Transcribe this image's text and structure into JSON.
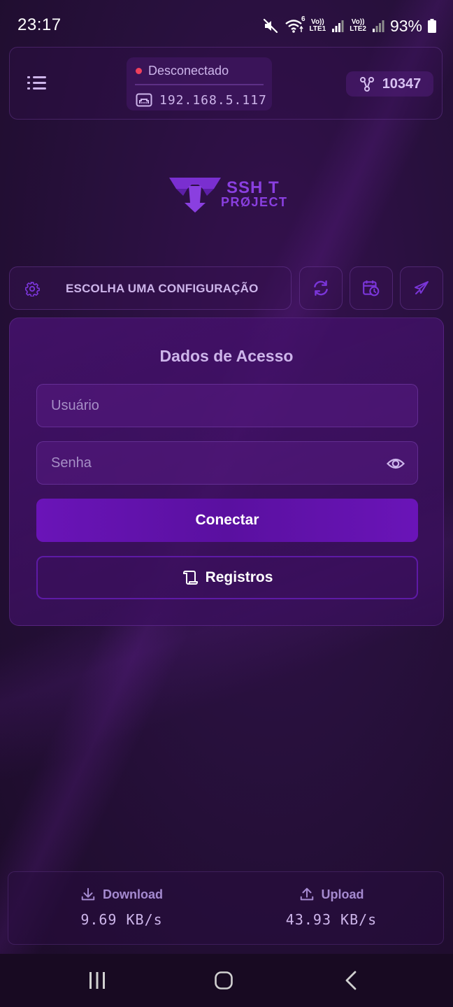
{
  "status_bar": {
    "time": "23:17",
    "sim1_top": "Vo))",
    "sim1_bottom": "LTE1",
    "sim2_top": "Vo))",
    "sim2_bottom": "LTE2",
    "wifi_badge": "6",
    "battery": "93%"
  },
  "header": {
    "connection_status": "Desconectado",
    "status_color": "#f0405c",
    "ip_address": "192.168.5.117",
    "counter": "10347"
  },
  "logo": {
    "line1": "SSH T",
    "line2": "PRØJECT",
    "color": "#8a3fe0"
  },
  "config": {
    "label": "ESCOLHA UMA CONFIGURAÇÃO",
    "icons": [
      "gear-icon",
      "refresh-icon",
      "calendar-clock-icon",
      "airplane-icon"
    ]
  },
  "access": {
    "title": "Dados de Acesso",
    "username_placeholder": "Usuário",
    "username_value": "",
    "password_placeholder": "Senha",
    "password_value": "",
    "connect_label": "Conectar",
    "logs_label": "Registros"
  },
  "traffic": {
    "download_label": "Download",
    "download_value": "9.69 KB/s",
    "upload_label": "Upload",
    "upload_value": "43.93 KB/s"
  },
  "colors": {
    "accent": "#6a14b8",
    "text_light": "#cdb5ea",
    "background": "#28103d"
  }
}
